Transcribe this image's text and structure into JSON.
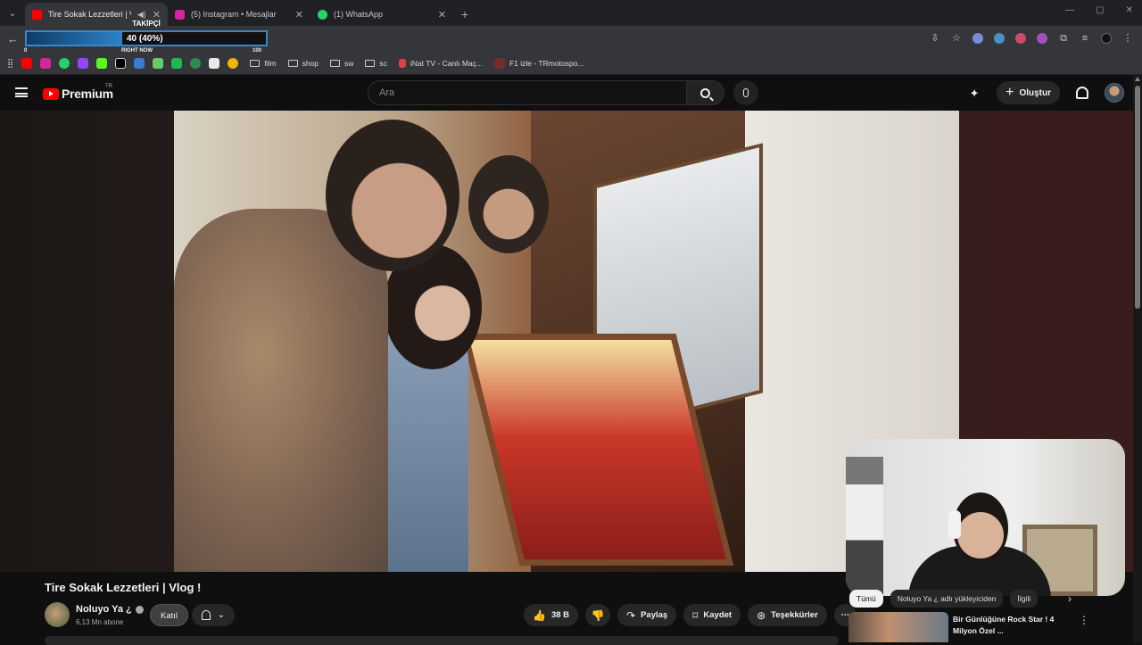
{
  "browser": {
    "tabs": [
      {
        "title": "Tire Sokak Lezzetleri | Vlog",
        "favicon_color": "#ff0000",
        "active": true
      },
      {
        "title": "(5) Instagram • Mesajlar",
        "favicon_color": "#d6249f",
        "active": false
      },
      {
        "title": "(1) WhatsApp",
        "favicon_color": "#25d366",
        "active": false
      }
    ],
    "new_tab": "+",
    "window_controls": [
      "—",
      "▢",
      "✕"
    ]
  },
  "overlay": {
    "label": "TAKİPÇİ",
    "value_text": "40 (40%)",
    "progress_percent": 40,
    "min": "0",
    "marker": "RIGHT NOW",
    "max": "100",
    "accent": "#2d82c9"
  },
  "bookmarks": {
    "icon_colors": [
      "#ff0000",
      "#d6249f",
      "#25d366",
      "#9146ff",
      "#53fc18",
      "#ffffff",
      "#3a7bd5",
      "#66cc66",
      "#1db954",
      "#2e8b57",
      "#e9e9e9",
      "#f4b400"
    ],
    "folders": [
      "film",
      "shop",
      "sw",
      "sc"
    ],
    "sites": [
      "iNat TV - Canlı Maç...",
      "F1 izle - TRmotospo..."
    ]
  },
  "youtube": {
    "brand": "Premium",
    "region": "TR",
    "search_placeholder": "Ara",
    "create_label": "Oluştur"
  },
  "video": {
    "title": "Tire Sokak Lezzetleri | Vlog !",
    "channel": "Noluyo Ya ¿",
    "subscribers": "6,13 Mn abone",
    "join_label": "Katıl",
    "likes": "38 B",
    "share_label": "Paylaş",
    "save_label": "Kaydet",
    "thanks_label": "Teşekkürler",
    "more_label": "⋯"
  },
  "sidebar": {
    "chips": [
      "Tümü",
      "Noluyo Ya ¿ adlı yükleyiciden",
      "İlgili"
    ],
    "recommendation": {
      "title": "Bir Günlüğüne Rock Star ! 4 Milyon Özel ..."
    }
  }
}
